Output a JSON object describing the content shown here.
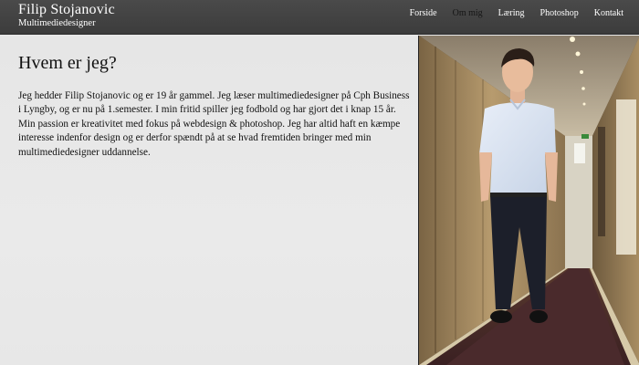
{
  "brand": {
    "name": "Filip Stojanovic",
    "subtitle": "Multimediedesigner"
  },
  "nav": {
    "items": [
      {
        "label": "Forside",
        "active": false
      },
      {
        "label": "Om mig",
        "active": true
      },
      {
        "label": "Læring",
        "active": false
      },
      {
        "label": "Photoshop",
        "active": false
      },
      {
        "label": "Kontakt",
        "active": false
      }
    ]
  },
  "main": {
    "title": "Hvem er jeg?",
    "intro": "Jeg hedder Filip Stojanovic og er 19 år gammel. Jeg læser multimediedesigner på Cph Business i Lyngby, og er nu på 1.semester. I min fritid spiller jeg fodbold og har gjort det i knap 15 år. Min passion er kreativitet med fokus på webdesign & photoshop. Jeg har altid haft en kæmpe interesse indenfor design og er derfor spændt på at se hvad fremtiden bringer med min multimediedesigner uddannelse."
  },
  "colors": {
    "header": "#444444",
    "active_nav": "#151515",
    "background": "#e8e8e8"
  }
}
